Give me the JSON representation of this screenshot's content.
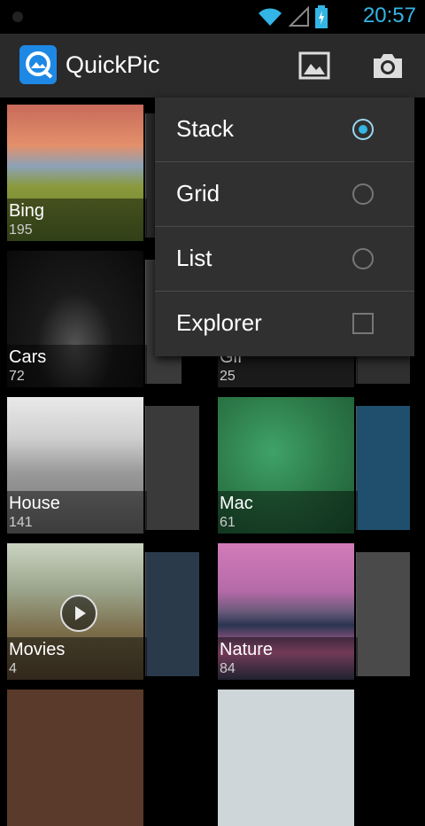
{
  "status_bar": {
    "time": "20:57"
  },
  "app": {
    "title": "QuickPic"
  },
  "toolbar": {
    "gallery_icon": "image-icon",
    "camera_icon": "camera-icon"
  },
  "menu": {
    "items": [
      {
        "label": "Stack",
        "control": "radio",
        "selected": true
      },
      {
        "label": "Grid",
        "control": "radio",
        "selected": false
      },
      {
        "label": "List",
        "control": "radio",
        "selected": false
      },
      {
        "label": "Explorer",
        "control": "checkbox",
        "selected": false
      }
    ]
  },
  "albums": [
    {
      "name": "Bing",
      "count": "195"
    },
    {
      "name": "Cars",
      "count": "72"
    },
    {
      "name": "Gif",
      "count": "25"
    },
    {
      "name": "House",
      "count": "141"
    },
    {
      "name": "Mac",
      "count": "61"
    },
    {
      "name": "Movies",
      "count": "4"
    },
    {
      "name": "Nature",
      "count": "84"
    }
  ],
  "colors": {
    "accent": "#33b5e5",
    "action_bar": "#2a2a2a",
    "menu_bg": "#303030"
  }
}
